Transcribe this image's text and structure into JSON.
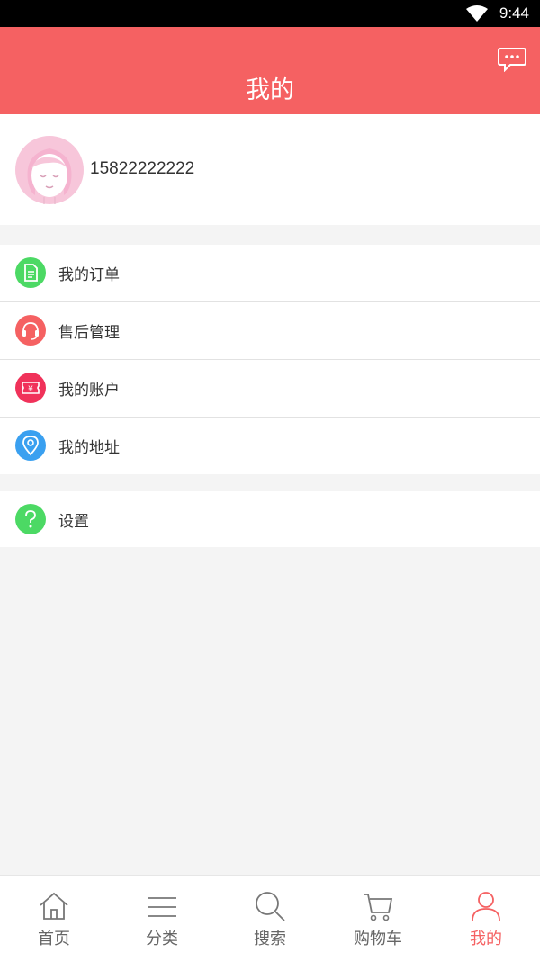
{
  "status_bar": {
    "time": "9:44"
  },
  "header": {
    "title": "我的"
  },
  "profile": {
    "phone": "15822222222"
  },
  "menu_group_1": [
    {
      "label": "我的订单",
      "icon": "order-document-icon",
      "color": "#4cd964"
    },
    {
      "label": "售后管理",
      "icon": "headset-icon",
      "color": "#f56162"
    },
    {
      "label": "我的账户",
      "icon": "yuan-ticket-icon",
      "color": "#f0325a"
    },
    {
      "label": "我的地址",
      "icon": "location-pin-icon",
      "color": "#3aa0f0"
    }
  ],
  "menu_group_2": [
    {
      "label": "设置",
      "icon": "question-icon",
      "color": "#4cd964"
    }
  ],
  "tabbar": [
    {
      "label": "首页",
      "icon": "home-icon"
    },
    {
      "label": "分类",
      "icon": "menu-lines-icon"
    },
    {
      "label": "搜索",
      "icon": "search-icon"
    },
    {
      "label": "购物车",
      "icon": "cart-icon"
    },
    {
      "label": "我的",
      "icon": "person-icon",
      "active": true
    }
  ],
  "colors": {
    "primary": "#f56162",
    "text": "#333333",
    "inactive_tab": "#666666"
  }
}
